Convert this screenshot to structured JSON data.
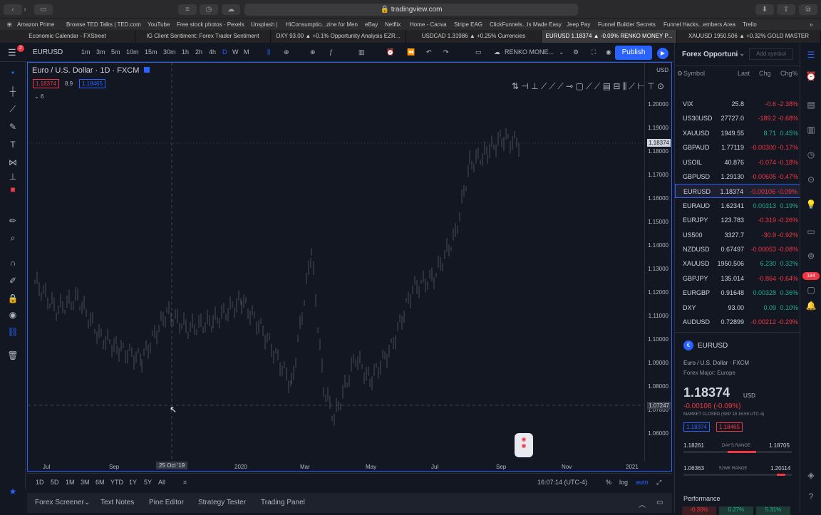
{
  "browser": {
    "url": "tradingview.com"
  },
  "bookmarks": [
    "Amazon Prime",
    "Browse TED Talks | TED.com",
    "YouTube",
    "Free stock photos · Pexels",
    "Unsplash |",
    "HiConsumptio...zine for Men",
    "eBay",
    "Netflix",
    "Home - Canva",
    "Stripe EAG",
    "ClickFunnels...Is Made Easy",
    "Jeep Pay",
    "Funnel Builder Secrets",
    "Funnel Hacks...embers Area",
    "Trello"
  ],
  "tabs": [
    "Economic Calendar - FXStreet",
    "IG Client Sentiment: Forex Trader Sentiment",
    "DXY 93.00 ▲ +0.1% Opportunity Analysis EZR...",
    "USDCAD 1.31986 ▲ +0.25% Currencies",
    "EURUSD 1.18374 ▲ -0.09% RENKO MONEY P...",
    "XAUUSD 1950.506 ▲ +0.32% GOLD MASTER"
  ],
  "toolbar": {
    "symbol": "EURUSD",
    "timeframes": [
      "1m",
      "3m",
      "5m",
      "10m",
      "15m",
      "30m",
      "1h",
      "2h",
      "4h",
      "D",
      "W",
      "M"
    ],
    "layout_name": "RENKO MONE...",
    "publish": "Publish"
  },
  "chart": {
    "title": "Euro / U.S. Dollar",
    "interval": "1D",
    "exchange": "FXCM",
    "currency": "USD",
    "sell": "1.18374",
    "spread": "8.9",
    "buy": "1.18465",
    "indicator_count": "6",
    "current_price_label": "1.18374",
    "crosshair_price": "1.07247",
    "crosshair_date": "25 Oct '19",
    "price_ticks": [
      "1.20000",
      "1.19000",
      "1.18000",
      "1.17000",
      "1.16000",
      "1.15000",
      "1.14000",
      "1.13000",
      "1.12000",
      "1.11000",
      "1.10000",
      "1.09000",
      "1.08000",
      "1.07000",
      "1.06000"
    ],
    "x_ticks": [
      "Jul",
      "Sep",
      "2020",
      "Mar",
      "May",
      "Jul",
      "Sep",
      "Nov",
      "2021"
    ]
  },
  "bottom": {
    "ranges": [
      "1D",
      "5D",
      "1M",
      "3M",
      "6M",
      "YTD",
      "1Y",
      "5Y",
      "All"
    ],
    "time": "16:07:14 (UTC-4)",
    "percent": "%",
    "log": "log",
    "auto": "auto"
  },
  "panels": [
    "Forex Screener",
    "Text Notes",
    "Pine Editor",
    "Strategy Tester",
    "Trading Panel"
  ],
  "watchlist": {
    "name": "Forex Opportuni",
    "add_symbol": "Add symbol",
    "headers": [
      "Symbol",
      "Last",
      "Chg",
      "Chg%"
    ],
    "rows": [
      {
        "sym": "VIX",
        "last": "25.8",
        "chg": "-0.6",
        "pct": "-2.38%",
        "dir": "red"
      },
      {
        "sym": "US30USD",
        "last": "27727.0",
        "chg": "-189.2",
        "pct": "-0.68%",
        "dir": "red"
      },
      {
        "sym": "XAUUSD",
        "last": "1949.55",
        "chg": "8.71",
        "pct": "0.45%",
        "dir": "green"
      },
      {
        "sym": "GBPAUD",
        "last": "1.77119",
        "chg": "-0.00300",
        "pct": "-0.17%",
        "dir": "red"
      },
      {
        "sym": "USOIL",
        "last": "40.876",
        "chg": "-0.074",
        "pct": "-0.18%",
        "dir": "red"
      },
      {
        "sym": "GBPUSD",
        "last": "1.29130",
        "chg": "-0.00605",
        "pct": "-0.47%",
        "dir": "red"
      },
      {
        "sym": "EURUSD",
        "last": "1.18374",
        "chg": "-0.00106",
        "pct": "-0.09%",
        "dir": "red"
      },
      {
        "sym": "EURAUD",
        "last": "1.62341",
        "chg": "0.00313",
        "pct": "0.19%",
        "dir": "green"
      },
      {
        "sym": "EURJPY",
        "last": "123.783",
        "chg": "-0.319",
        "pct": "-0.26%",
        "dir": "red"
      },
      {
        "sym": "US500",
        "last": "3327.7",
        "chg": "-30.9",
        "pct": "-0.92%",
        "dir": "red"
      },
      {
        "sym": "NZDUSD",
        "last": "0.67497",
        "chg": "-0.00053",
        "pct": "-0.08%",
        "dir": "red"
      },
      {
        "sym": "XAUUSD",
        "last": "1950.506",
        "chg": "6.230",
        "pct": "0.32%",
        "dir": "green"
      },
      {
        "sym": "GBPJPY",
        "last": "135.014",
        "chg": "-0.864",
        "pct": "-0.64%",
        "dir": "red"
      },
      {
        "sym": "EURGBP",
        "last": "0.91648",
        "chg": "0.00328",
        "pct": "0.36%",
        "dir": "green"
      },
      {
        "sym": "DXY",
        "last": "93.00",
        "chg": "0.09",
        "pct": "0.10%",
        "dir": "green"
      },
      {
        "sym": "AUDUSD",
        "last": "0.72899",
        "chg": "-0.00212",
        "pct": "-0.29%",
        "dir": "red"
      }
    ]
  },
  "details": {
    "symbol": "EURUSD",
    "name": "Euro / U.S. Dollar · FXCM",
    "category": "Forex Major: Europe",
    "price": "1.18374",
    "currency": "USD",
    "change": "-0.00106 (-0.09%)",
    "status": "MARKET CLOSED  (SEP 18 16:59 UTC-4)",
    "bid": "1.18374",
    "ask": "1.18465",
    "day_low": "1.18261",
    "day_label": "DAY'S RANGE",
    "day_high": "1.18705",
    "wk_low": "1.06363",
    "wk_label": "52WK RANGE",
    "wk_high": "1.20114",
    "performance": "Performance",
    "perf_values": [
      "-0.30%",
      "0.27%",
      "5.31%"
    ]
  },
  "badges": {
    "notif": "2",
    "alerts": "184"
  },
  "colors": {
    "accent": "#2962ff",
    "red": "#f23645",
    "green": "#22ab94"
  }
}
